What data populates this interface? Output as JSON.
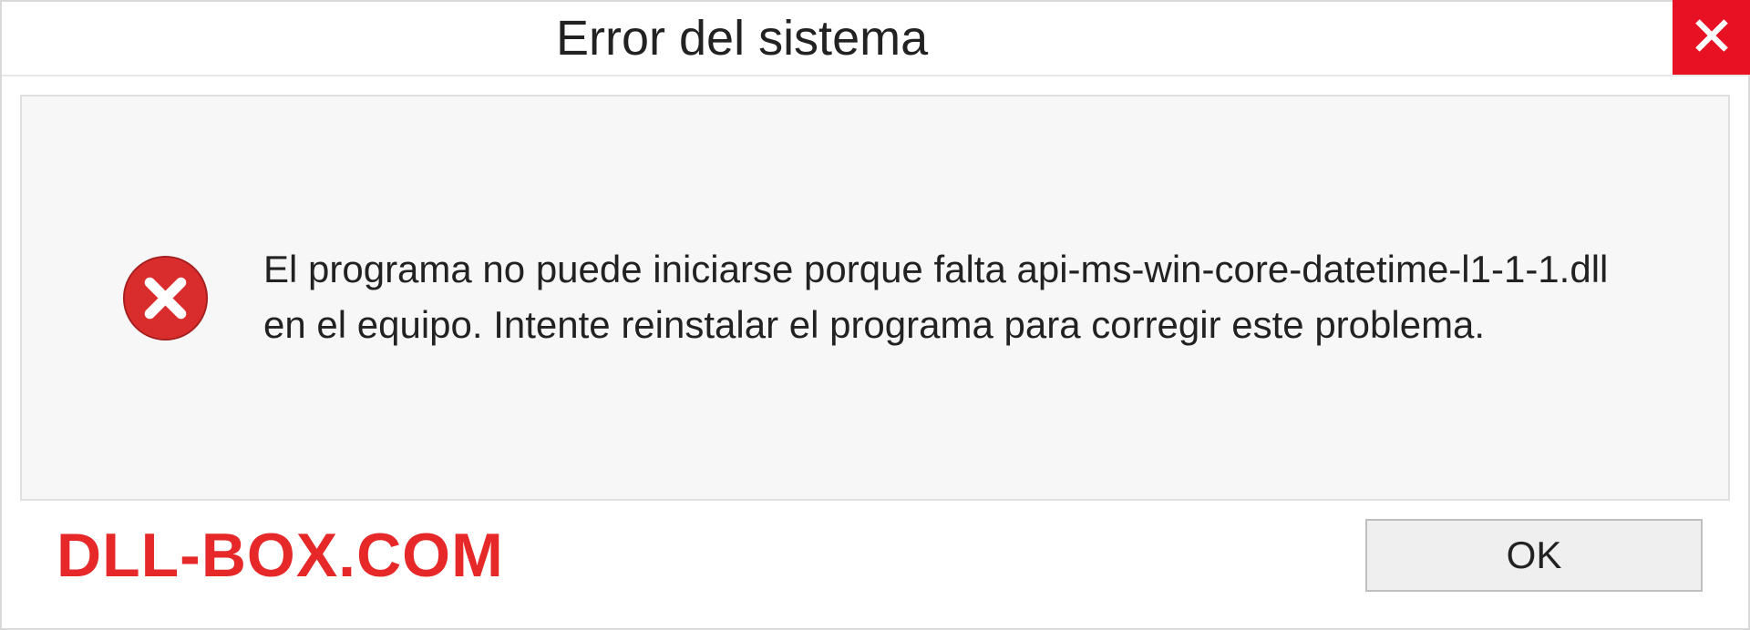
{
  "titlebar": {
    "title": "Error del sistema"
  },
  "message": {
    "text": "El programa no puede iniciarse porque falta api-ms-win-core-datetime-l1-1-1.dll en el equipo. Intente reinstalar el programa para corregir este problema."
  },
  "footer": {
    "watermark": "DLL-BOX.COM",
    "ok_label": "OK"
  },
  "icons": {
    "close": "close-icon",
    "error": "error-circle-x-icon"
  },
  "colors": {
    "close_bg": "#e81123",
    "error_icon": "#d92c2c",
    "watermark": "#e62828"
  }
}
